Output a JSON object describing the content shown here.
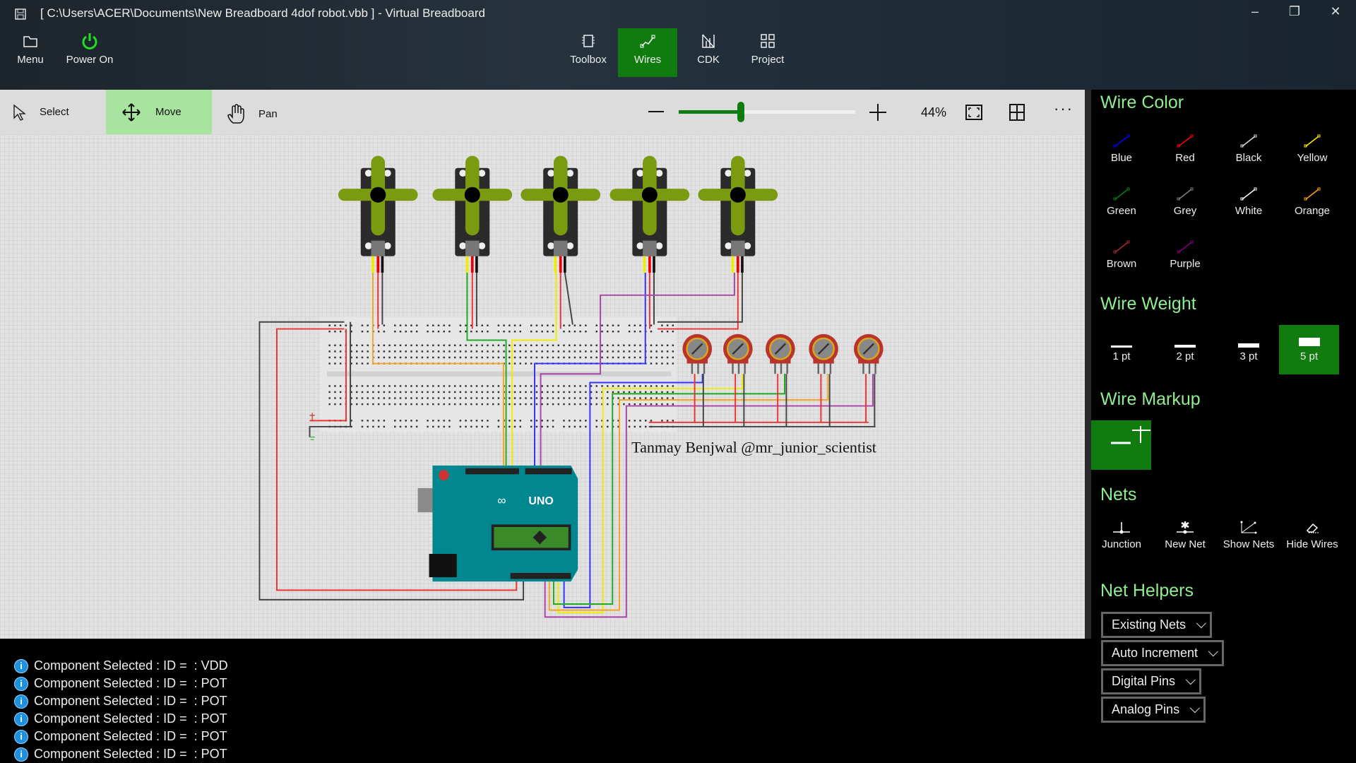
{
  "window": {
    "title": "[ C:\\Users\\ACER\\Documents\\New Breadboard 4dof robot.vbb ] - Virtual Breadboard",
    "minimize": "–",
    "restore": "❐",
    "close": "✕"
  },
  "topbar": {
    "menu": "Menu",
    "power": "Power On",
    "toolbox": "Toolbox",
    "wires": "Wires",
    "cdk": "CDK",
    "project": "Project",
    "selected": "Wires"
  },
  "toolrow": {
    "select": "Select",
    "move": "Move",
    "pan": "Pan",
    "active": "Move",
    "zoom_label": "44%",
    "zoom_percent": 44
  },
  "canvas": {
    "credit": "Tanmay Benjwal @mr_junior_scientist",
    "board_label": "UNO"
  },
  "panel": {
    "wire_color": {
      "title": "Wire Color",
      "items": [
        {
          "label": "Blue",
          "color": "#0000ff"
        },
        {
          "label": "Red",
          "color": "#ff0000"
        },
        {
          "label": "Black",
          "color": "#dddddd"
        },
        {
          "label": "Yellow",
          "color": "#ffee00"
        },
        {
          "label": "Green",
          "color": "#008000"
        },
        {
          "label": "Grey",
          "color": "#808080"
        },
        {
          "label": "White",
          "color": "#ffffff"
        },
        {
          "label": "Orange",
          "color": "#ffa500"
        },
        {
          "label": "Brown",
          "color": "#a52a2a"
        },
        {
          "label": "Purple",
          "color": "#800080"
        }
      ]
    },
    "wire_weight": {
      "title": "Wire Weight",
      "items": [
        {
          "label": "1 pt"
        },
        {
          "label": "2 pt"
        },
        {
          "label": "3 pt"
        },
        {
          "label": "5 pt"
        }
      ],
      "selected": "5 pt"
    },
    "wire_markup": {
      "title": "Wire Markup"
    },
    "nets": {
      "title": "Nets",
      "items": [
        {
          "label": "Junction",
          "icon": "junction-icon"
        },
        {
          "label": "New Net",
          "icon": "new-net-icon"
        },
        {
          "label": "Show Nets",
          "icon": "show-nets-icon"
        },
        {
          "label": "Hide Wires",
          "icon": "eraser-icon"
        }
      ]
    },
    "net_helpers": {
      "title": "Net Helpers",
      "dropdowns": [
        {
          "label": "Existing Nets"
        },
        {
          "label": "Auto Increment"
        },
        {
          "label": "Digital Pins"
        },
        {
          "label": "Analog Pins"
        }
      ]
    }
  },
  "log": [
    {
      "text": "Component Selected : ID =  : VDD"
    },
    {
      "text": "Component Selected : ID =  : POT"
    },
    {
      "text": "Component Selected : ID =  : POT"
    },
    {
      "text": "Component Selected : ID =  : POT"
    },
    {
      "text": "Component Selected : ID =  : POT"
    },
    {
      "text": "Component Selected : ID =  : POT"
    }
  ],
  "colors": {
    "accent": "#107c10",
    "heading": "#90ee90",
    "move_highlight": "#a8e4a0"
  }
}
